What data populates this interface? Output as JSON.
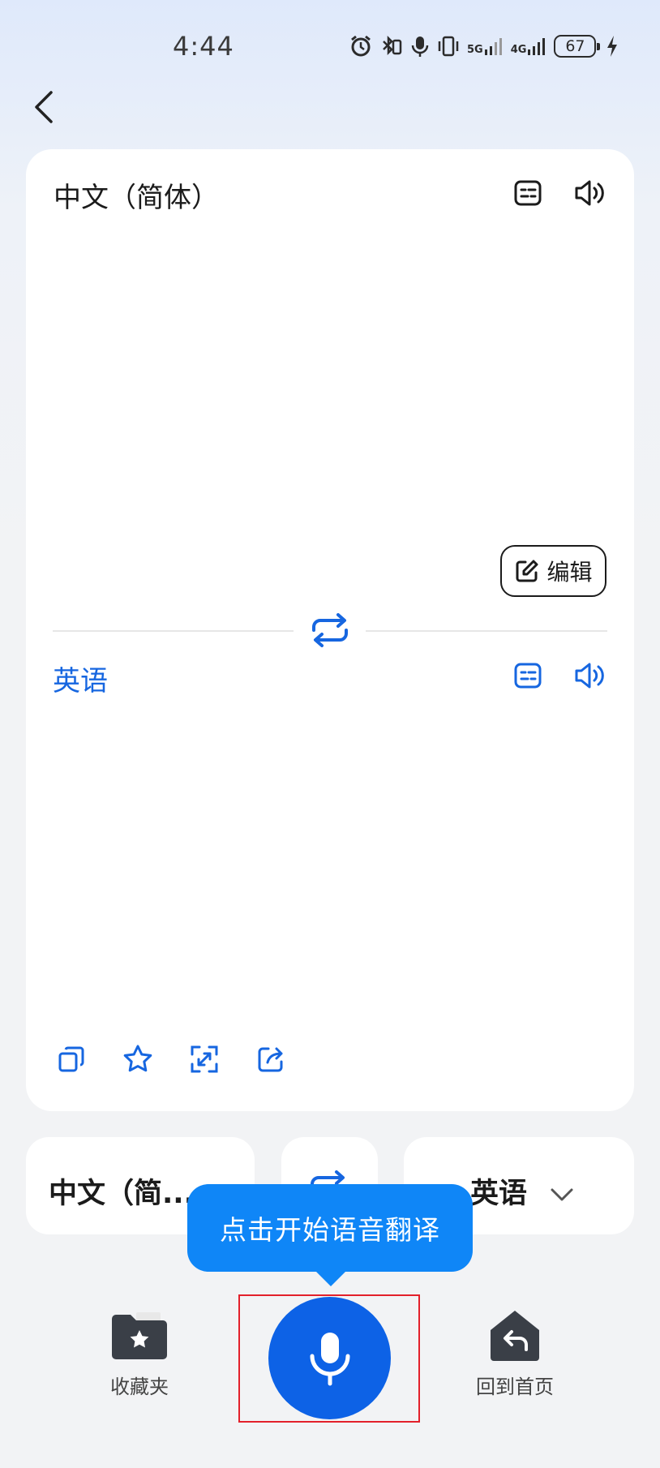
{
  "status_bar": {
    "time": "4:44",
    "battery": "67",
    "signal_1": "5G",
    "signal_2": "4G",
    "icons": [
      "alarm-icon",
      "bluetooth-icon",
      "mic-icon",
      "vibrate-icon",
      "signal-5g-icon",
      "signal-4g-icon",
      "battery-icon",
      "charging-icon"
    ]
  },
  "header": {
    "back_icon": "chevron-left-icon"
  },
  "source": {
    "language": "中文（简体）",
    "icons": [
      "subtitles-icon",
      "speaker-icon"
    ],
    "edit_label": "编辑"
  },
  "target": {
    "language": "英语",
    "icons": [
      "subtitles-icon",
      "speaker-icon"
    ],
    "tools": [
      "copy-icon",
      "star-icon",
      "fullscreen-icon",
      "share-icon"
    ]
  },
  "language_selector": {
    "left": "中文（简...",
    "right": "英语"
  },
  "tooltip": "点击开始语音翻译",
  "bottom_bar": {
    "favorites_label": "收藏夹",
    "home_label": "回到首页"
  },
  "colors": {
    "accent": "#1666e0",
    "mic_button": "#0d62e6",
    "tooltip": "#0f86f7",
    "highlight_frame": "#e3202b"
  }
}
